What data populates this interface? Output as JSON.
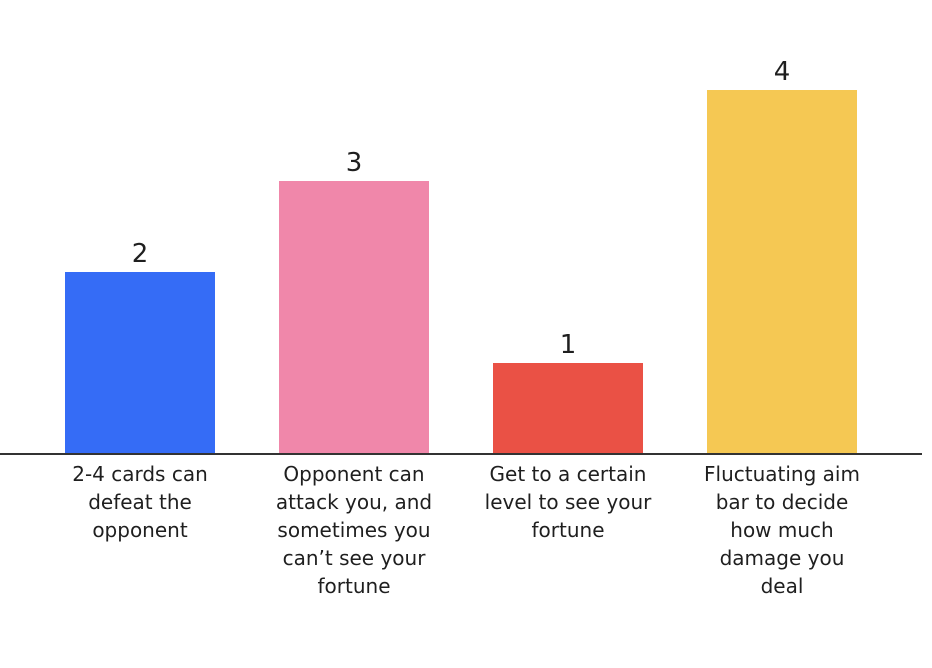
{
  "chart_data": {
    "type": "bar",
    "categories": [
      "2-4 cards can defeat the opponent",
      "Opponent can attack you, and sometimes you can’t see your fortune",
      "Get to a certain level to see your fortune",
      "Fluctuating aim bar to decide how much damage you deal"
    ],
    "values": [
      2,
      3,
      1,
      4
    ],
    "colors": [
      "#356cf6",
      "#f087aa",
      "#ea5145",
      "#f5c853"
    ],
    "ylim": [
      0,
      4
    ],
    "grid": false,
    "legend": "none",
    "title": "",
    "xlabel": "",
    "ylabel": ""
  }
}
